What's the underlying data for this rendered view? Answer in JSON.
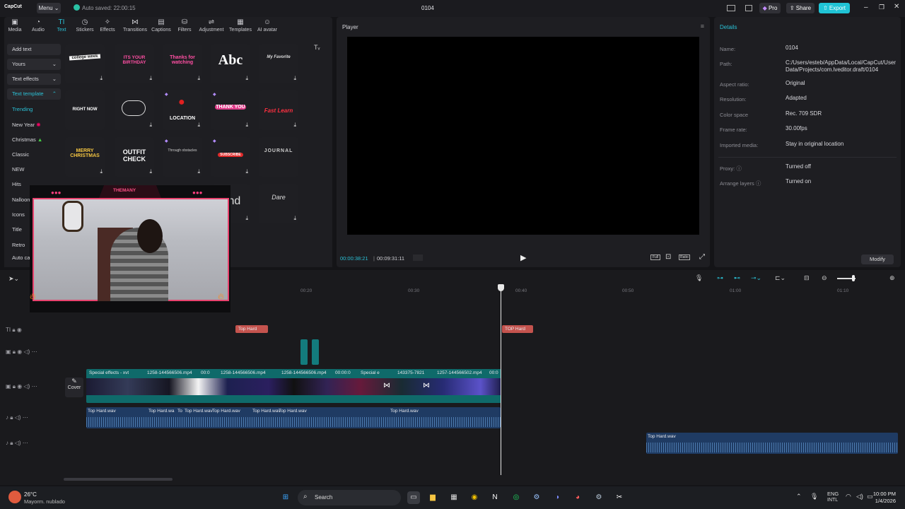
{
  "titlebar": {
    "app_name": "CapCut",
    "menu_label": "Menu",
    "autosave": "Auto saved: 22:00:15",
    "project_title": "0104",
    "pro_label": "Pro",
    "share_label": "Share",
    "export_label": "Export"
  },
  "toolbar": {
    "tabs": [
      {
        "label": "Media",
        "icon": "media-icon"
      },
      {
        "label": "Audio",
        "icon": "audio-icon"
      },
      {
        "label": "Text",
        "icon": "text-icon"
      },
      {
        "label": "Stickers",
        "icon": "stickers-icon"
      },
      {
        "label": "Effects",
        "icon": "effects-icon"
      },
      {
        "label": "Transitions",
        "icon": "transitions-icon"
      },
      {
        "label": "Captions",
        "icon": "captions-icon"
      },
      {
        "label": "Filters",
        "icon": "filters-icon"
      },
      {
        "label": "Adjustment",
        "icon": "adjustment-icon"
      },
      {
        "label": "Templates",
        "icon": "templates-icon"
      },
      {
        "label": "AI avatar",
        "icon": "ai-avatar-icon"
      }
    ],
    "active": "Text"
  },
  "leftpanel": {
    "add_text": "Add text",
    "yours": "Yours",
    "text_effects": "Text effects",
    "text_template": "Text template",
    "categories": [
      "Trending",
      "New Year",
      "Christmas",
      "Classic",
      "NEW",
      "Hits",
      "Nalloon",
      "Icons",
      "Title",
      "Retro",
      "Auto cap"
    ]
  },
  "templates": {
    "items": [
      "college week",
      "ITS YOUR BIRTHDAY",
      "Thanks for watching",
      "Abc",
      "My Favorite",
      "RIGHT NOW",
      "",
      "LOCATION",
      "THANK YOU",
      "Fast Learn",
      "MERRY CHRISTMAS",
      "OUTFIT CHECK",
      "Through obstacles",
      "SUBSCRIBE",
      "JOURNAL",
      "",
      "",
      "",
      "End",
      "Dare"
    ]
  },
  "webcam": {
    "brand": "THEMANY"
  },
  "player": {
    "title": "Player",
    "current_time": "00:00:38:21",
    "total_time": "00:09:31:11",
    "full_label": "Full",
    "ratio_label": "Ratio"
  },
  "details": {
    "title": "Details",
    "rows": [
      {
        "key": "Name:",
        "value": "0104"
      },
      {
        "key": "Path:",
        "value": "C:/Users/esteb/AppData/Local/CapCut/User Data/Projects/com.lveditor.draft/0104"
      },
      {
        "key": "Aspect ratio:",
        "value": "Original"
      },
      {
        "key": "Resolution:",
        "value": "Adapted"
      },
      {
        "key": "Color space",
        "value": "Rec. 709 SDR"
      },
      {
        "key": "Frame rate:",
        "value": "30.00fps"
      },
      {
        "key": "Imported media:",
        "value": "Stay in original location"
      },
      {
        "key": "Proxy:",
        "value": "Turned off"
      },
      {
        "key": "Arrange layers",
        "value": "Turned on"
      }
    ],
    "modify_label": "Modify"
  },
  "timeline": {
    "ruler": [
      "00:20",
      "00:30",
      "00:40",
      "00:50",
      "01:00",
      "01:10"
    ],
    "text_clips": [
      "Top Hard",
      "TOP Hard"
    ],
    "video_clips": [
      "Special effects - xvt",
      "1258-144566506.mp4",
      "00:0",
      "1258-144566506.mp4",
      "1258-144566506.mp4",
      "00:00:0",
      "Special e",
      "143375-7821",
      "1257-144566502.mp4",
      "00:0"
    ],
    "audio_clips": [
      "Top Hard.wav",
      "Top Hard.wa",
      "To",
      "Top Hard.wav",
      "Top Hard.wav",
      "Top Hard.wav",
      "Top Hard.wav",
      "Top Hard.wav"
    ],
    "audio2_clip": "Top Hard.wav",
    "cover_label": "Cover"
  },
  "taskbar": {
    "weather_temp": "26°C",
    "weather_desc": "Mayorm. nublado",
    "search_label": "Search",
    "lang_1": "ENG",
    "lang_2": "INTL",
    "time": "10:00 PM",
    "date": "1/4/2026"
  }
}
